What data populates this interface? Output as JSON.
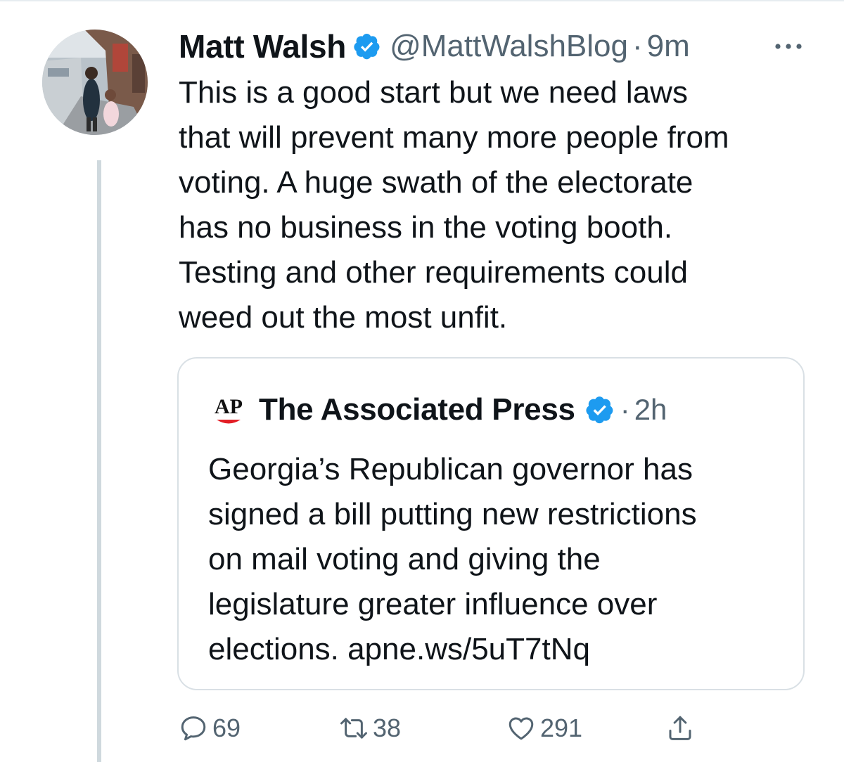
{
  "tweet": {
    "author_name": "Matt Walsh",
    "handle": "@MattWalshBlog",
    "separator": "·",
    "time": "9m",
    "verified": true,
    "text": "This is a good start but we need laws\nthat will prevent many more people from\nvoting. A huge swath of the electorate\nhas no business in the voting booth.\nTesting and other requirements could\nweed out the most unfit."
  },
  "quoted_tweet": {
    "logo_text": "AP",
    "author_name": "The Associated Press",
    "verified": true,
    "separator": "·",
    "time": "2h",
    "text": "Georgia’s Republican governor has\nsigned a bill putting new restrictions\non mail voting and giving the\nlegislature greater influence over\nelections. apne.ws/5uT7tNq"
  },
  "actions": {
    "reply_count": "69",
    "retweet_count": "38",
    "like_count": "291"
  },
  "icons": [
    "avatar-photo",
    "verified-badge-icon",
    "more-options-icon",
    "ap-logo",
    "reply-icon",
    "retweet-icon",
    "like-icon",
    "share-icon"
  ],
  "colors": {
    "text": "#0f1419",
    "secondary_text": "#536471",
    "verified_blue": "#1d9bf0",
    "border": "#d9e0e5",
    "thread_line": "#cfd9de",
    "ap_red": "#e31e26"
  }
}
